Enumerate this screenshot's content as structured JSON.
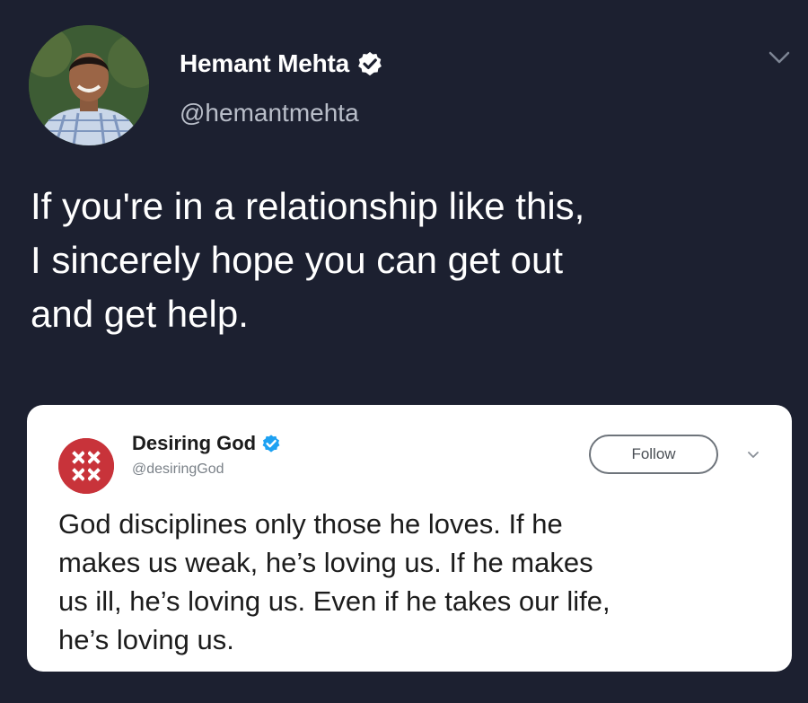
{
  "tweet": {
    "author": {
      "display_name": "Hemant Mehta",
      "handle": "@hemantmehta",
      "verified": true,
      "avatar_icon": "profile-photo"
    },
    "menu_icon": "chevron-down-icon",
    "text": "If you're in a relationship like this,\nI sincerely hope you can get out\nand get help."
  },
  "quoted_tweet": {
    "author": {
      "display_name": "Desiring God",
      "handle": "@desiringGod",
      "verified": true,
      "logo_icon": "desiring-god-logo"
    },
    "follow_label": "Follow",
    "menu_icon": "chevron-down-icon",
    "text": "God disciplines only those he loves. If he\nmakes us weak, he’s loving us. If he makes\nus ill, he’s loving us. Even if he takes our life,\nhe’s loving us."
  },
  "colors": {
    "background": "#1c2030",
    "verified_blue": "#1da1f2",
    "logo_red": "#c8333a",
    "card_background": "#ffffff"
  }
}
